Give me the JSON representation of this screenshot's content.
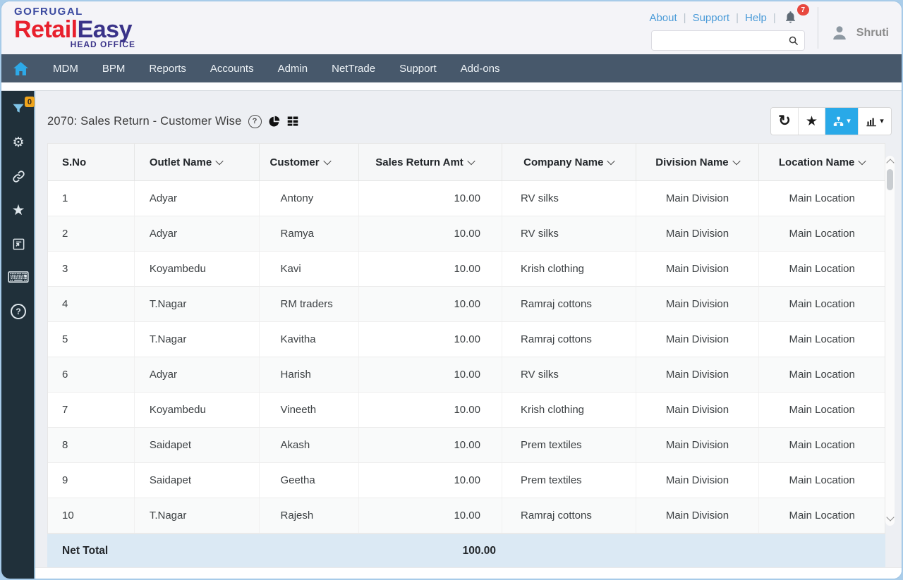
{
  "header": {
    "logo": {
      "brand": "GOFRUGAL",
      "product_red": "Retail",
      "product_blue": "Easy",
      "subtitle": "HEAD OFFICE"
    },
    "links": [
      "About",
      "Support",
      "Help"
    ],
    "notification_count": "7",
    "search": {
      "value": "",
      "placeholder": ""
    },
    "user_name": "Shruti"
  },
  "nav": {
    "items": [
      "MDM",
      "BPM",
      "Reports",
      "Accounts",
      "Admin",
      "NetTrade",
      "Support",
      "Add-ons"
    ]
  },
  "sidebar": {
    "filter_badge": "0",
    "icons": [
      "filter",
      "settings",
      "link",
      "favorites",
      "report-window",
      "keyboard",
      "help"
    ]
  },
  "report": {
    "title": "2070: Sales Return -  Customer Wise",
    "title_icons": [
      "help-circle",
      "pie-chart",
      "table-grid"
    ],
    "toolbar": [
      "refresh",
      "favorite",
      "hierarchy-view",
      "chart-view"
    ]
  },
  "table": {
    "columns": [
      {
        "label": "S.No",
        "sortable": false
      },
      {
        "label": "Outlet Name",
        "sortable": true
      },
      {
        "label": "Customer",
        "sortable": true
      },
      {
        "label": "Sales Return Amt",
        "sortable": true
      },
      {
        "label": "Company Name",
        "sortable": true
      },
      {
        "label": "Division  Name",
        "sortable": true
      },
      {
        "label": "Location Name",
        "sortable": true
      }
    ],
    "rows": [
      [
        "1",
        "Adyar",
        "Antony",
        "10.00",
        "RV silks",
        "Main Division",
        "Main Location"
      ],
      [
        "2",
        "Adyar",
        "Ramya",
        "10.00",
        "RV silks",
        "Main Division",
        "Main Location"
      ],
      [
        "3",
        "Koyambedu",
        "Kavi",
        "10.00",
        "Krish clothing",
        "Main Division",
        "Main Location"
      ],
      [
        "4",
        "T.Nagar",
        "RM traders",
        "10.00",
        "Ramraj cottons",
        "Main Division",
        "Main Location"
      ],
      [
        "5",
        "T.Nagar",
        "Kavitha",
        "10.00",
        "Ramraj cottons",
        "Main Division",
        "Main Location"
      ],
      [
        "6",
        "Adyar",
        "Harish",
        "10.00",
        "RV silks",
        "Main Division",
        "Main Location"
      ],
      [
        "7",
        "Koyambedu",
        "Vineeth",
        "10.00",
        "Krish clothing",
        "Main Division",
        "Main Location"
      ],
      [
        "8",
        "Saidapet",
        "Akash",
        "10.00",
        "Prem textiles",
        "Main Division",
        "Main Location"
      ],
      [
        "9",
        "Saidapet",
        "Geetha",
        "10.00",
        "Prem textiles",
        "Main Division",
        "Main Location"
      ],
      [
        "10",
        "T.Nagar",
        "Rajesh",
        "10.00",
        "Ramraj cottons",
        "Main Division",
        "Main Location"
      ]
    ],
    "net_total_label": "Net Total",
    "net_total_value": "100.00"
  },
  "colors": {
    "accent_blue": "#29a9e8",
    "nav_bg": "#47586b",
    "sidebar_bg": "#20303a",
    "net_total_bg": "#dbe9f4",
    "notification_red": "#e8483f",
    "filter_badge_amber": "#f0a51c",
    "link_blue": "#4a9bd8",
    "logo_red": "#e8202d",
    "logo_indigo": "#3a3389"
  }
}
